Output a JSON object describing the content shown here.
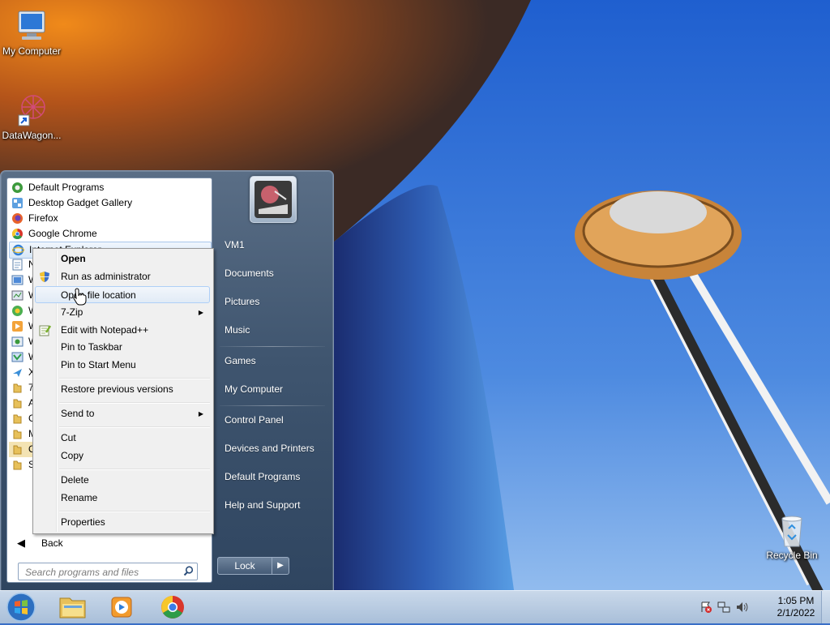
{
  "desktop": {
    "icons": [
      {
        "label": "My Computer"
      },
      {
        "label": "DataWagon..."
      },
      {
        "label": "Recycle Bin"
      }
    ]
  },
  "start_menu": {
    "programs": [
      {
        "label": "Default Programs",
        "icon": "default-programs-icon"
      },
      {
        "label": "Desktop Gadget Gallery",
        "icon": "gadget-gallery-icon"
      },
      {
        "label": "Firefox",
        "icon": "firefox-icon"
      },
      {
        "label": "Google Chrome",
        "icon": "chrome-icon"
      },
      {
        "label": "Internet Explorer",
        "icon": "ie-icon"
      },
      {
        "label": "N",
        "icon": "notepad-icon"
      },
      {
        "label": "W",
        "icon": "program-icon"
      },
      {
        "label": "W",
        "icon": "program-icon"
      },
      {
        "label": "W",
        "icon": "program-icon"
      },
      {
        "label": "W",
        "icon": "media-icon"
      },
      {
        "label": "W",
        "icon": "program-icon"
      },
      {
        "label": "W",
        "icon": "program-icon"
      },
      {
        "label": "X",
        "icon": "program-icon"
      },
      {
        "label": "7",
        "icon": "folder-icon"
      },
      {
        "label": "A",
        "icon": "folder-icon"
      },
      {
        "label": "G",
        "icon": "folder-icon"
      },
      {
        "label": "M",
        "icon": "folder-icon"
      },
      {
        "label": "O",
        "icon": "folder-icon"
      },
      {
        "label": "S",
        "icon": "folder-icon"
      }
    ],
    "back_label": "Back",
    "search_placeholder": "Search programs and files",
    "right_column": [
      {
        "label": "VM1"
      },
      {
        "label": "Documents"
      },
      {
        "label": "Pictures"
      },
      {
        "label": "Music"
      },
      {
        "label": "Games"
      },
      {
        "label": "My Computer"
      },
      {
        "label": "Control Panel"
      },
      {
        "label": "Devices and Printers"
      },
      {
        "label": "Default Programs"
      },
      {
        "label": "Help and Support"
      }
    ],
    "lock_label": "Lock"
  },
  "context_menu": {
    "items": [
      {
        "label": "Open"
      },
      {
        "label": "Run as administrator",
        "icon": "uac-shield-icon"
      },
      {
        "label": "Open file location"
      },
      {
        "label": "7-Zip"
      },
      {
        "label": "Edit with Notepad++",
        "icon": "notepadpp-icon"
      },
      {
        "label": "Pin to Taskbar"
      },
      {
        "label": "Pin to Start Menu"
      },
      {
        "label": "Restore previous versions"
      },
      {
        "label": "Send to"
      },
      {
        "label": "Cut"
      },
      {
        "label": "Copy"
      },
      {
        "label": "Delete"
      },
      {
        "label": "Rename"
      },
      {
        "label": "Properties"
      }
    ]
  },
  "taskbar": {
    "pinned": [
      {
        "icon": "explorer-icon"
      },
      {
        "icon": "media-player-icon"
      },
      {
        "icon": "chrome-icon"
      }
    ],
    "clock": {
      "time": "1:05 PM",
      "date": "2/1/2022"
    }
  }
}
